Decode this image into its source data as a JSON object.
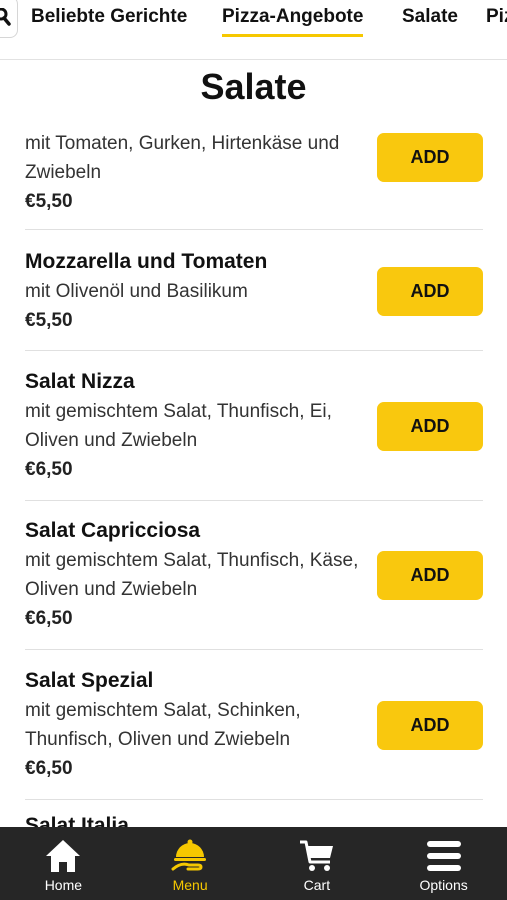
{
  "topnav": {
    "tabs": [
      {
        "label": "Beliebte Gerichte"
      },
      {
        "label": "Pizza-Angebote"
      },
      {
        "label": "Salate"
      },
      {
        "label": "Piz"
      }
    ]
  },
  "section": {
    "title": "Salate"
  },
  "items": [
    {
      "name": "",
      "desc": "mit Tomaten, Gurken, Hirtenkäse und Zwiebeln",
      "price": "€5,50",
      "button": "ADD"
    },
    {
      "name": "Mozzarella und Tomaten",
      "desc": "mit Olivenöl und Basilikum",
      "price": "€5,50",
      "button": "ADD"
    },
    {
      "name": "Salat Nizza",
      "desc": "mit gemischtem Salat, Thunfisch, Ei, Oliven und Zwiebeln",
      "price": "€6,50",
      "button": "ADD"
    },
    {
      "name": "Salat Capricciosa",
      "desc": "mit gemischtem Salat, Thunfisch, Käse, Oliven und Zwiebeln",
      "price": "€6,50",
      "button": "ADD"
    },
    {
      "name": "Salat Spezial",
      "desc": "mit gemischtem Salat, Schinken, Thunfisch, Oliven und Zwiebeln",
      "price": "€6,50",
      "button": "ADD"
    }
  ],
  "peek_item": {
    "name": "Salat Italia"
  },
  "bottomnav": {
    "items": [
      {
        "label": "Home",
        "icon": "home-icon"
      },
      {
        "label": "Menu",
        "icon": "serving-dish-icon"
      },
      {
        "label": "Cart",
        "icon": "cart-icon"
      },
      {
        "label": "Options",
        "icon": "menu-icon"
      }
    ]
  },
  "colors": {
    "accent": "#f9c80e",
    "nav_bg": "#262626",
    "active_nav": "#f6c800"
  }
}
